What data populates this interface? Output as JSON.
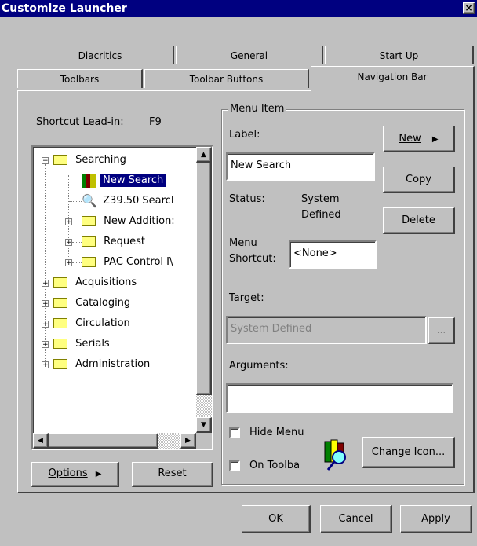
{
  "window": {
    "title": "Customize Launcher",
    "close": "×"
  },
  "tabs": {
    "row1": [
      "Diacritics",
      "General",
      "Start Up"
    ],
    "row2": [
      "Toolbars",
      "Toolbar Buttons",
      "Navigation Bar"
    ],
    "active": "Navigation Bar"
  },
  "left": {
    "shortcut_label": "Shortcut Lead-in:",
    "shortcut_value": "F9",
    "tree": [
      {
        "label": "Searching",
        "level": 0,
        "expanded": true
      },
      {
        "label": "New Search",
        "level": 1,
        "selected": true
      },
      {
        "label": "Z39.50 Searcl",
        "level": 1
      },
      {
        "label": "New Addition:",
        "level": 1
      },
      {
        "label": "Request",
        "level": 1
      },
      {
        "label": "PAC Control I\\",
        "level": 1
      },
      {
        "label": "Acquisitions",
        "level": 0
      },
      {
        "label": "Cataloging",
        "level": 0
      },
      {
        "label": "Circulation",
        "level": 0
      },
      {
        "label": "Serials",
        "level": 0
      },
      {
        "label": "Administration",
        "level": 0
      }
    ],
    "options_button": "Options",
    "options_arrow": "▶",
    "reset_button": "Reset"
  },
  "menu_item": {
    "group_label": "Menu Item",
    "label_caption": "Label:",
    "label_value": "New Search",
    "status_caption": "Status:",
    "status_value_1": "System",
    "status_value_2": "Defined",
    "menu_caption_1": "Menu",
    "menu_caption_2": "Shortcut:",
    "shortcut_value": "<None>",
    "target_caption": "Target:",
    "target_value": "System Defined",
    "browse": "...",
    "arguments_caption": "Arguments:",
    "arguments_value": "",
    "hide_menu": "Hide Menu",
    "on_toolbar": "On Toolba",
    "change_icon": "Change Icon...",
    "new_button": "New",
    "new_arrow": "▶",
    "copy_button": "Copy",
    "delete_button": "Delete"
  },
  "footer": {
    "ok": "OK",
    "cancel": "Cancel",
    "apply": "Apply"
  },
  "colors": {
    "titlebar": "#000080",
    "face": "#c0c0c0",
    "selection": "#000080"
  }
}
